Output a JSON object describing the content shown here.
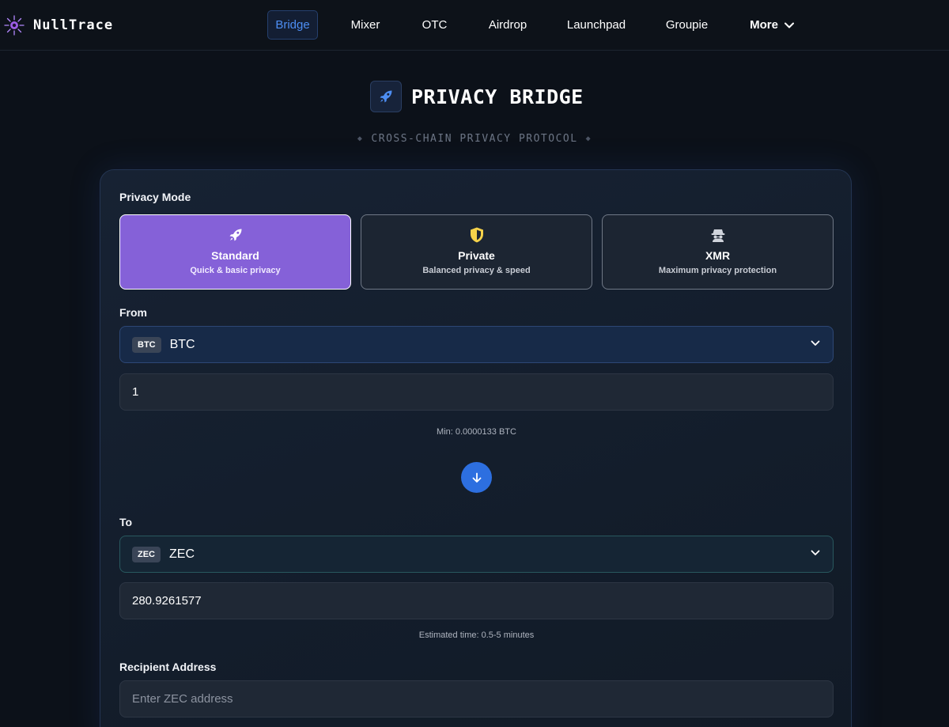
{
  "app": {
    "name": "NullTrace"
  },
  "nav": {
    "items": [
      {
        "label": "Bridge",
        "active": true
      },
      {
        "label": "Mixer"
      },
      {
        "label": "OTC"
      },
      {
        "label": "Airdrop"
      },
      {
        "label": "Launchpad"
      },
      {
        "label": "Groupie"
      }
    ],
    "more_label": "More"
  },
  "header": {
    "title": "PRIVACY BRIDGE",
    "subtitle": "CROSS-CHAIN PRIVACY PROTOCOL",
    "icon": "rocket-icon"
  },
  "privacy_mode": {
    "label": "Privacy Mode",
    "options": [
      {
        "title": "Standard",
        "desc": "Quick & basic privacy",
        "icon": "rocket-icon",
        "selected": true
      },
      {
        "title": "Private",
        "desc": "Balanced privacy & speed",
        "icon": "shield-icon",
        "selected": false
      },
      {
        "title": "XMR",
        "desc": "Maximum privacy protection",
        "icon": "incognito-icon",
        "selected": false
      }
    ]
  },
  "from": {
    "label": "From",
    "coin_badge": "BTC",
    "coin_name": "BTC",
    "amount": "1",
    "min_text": "Min: 0.0000133 BTC"
  },
  "to": {
    "label": "To",
    "coin_badge": "ZEC",
    "coin_name": "ZEC",
    "amount": "280.9261577",
    "estimate_text": "Estimated time: 0.5-5 minutes"
  },
  "recipient": {
    "label": "Recipient Address",
    "placeholder": "Enter ZEC address"
  },
  "colors": {
    "background": "#0c1119",
    "accent_blue": "#2d6fe0",
    "active_mode": "#8561d8",
    "shield_yellow": "#f5d24a"
  }
}
